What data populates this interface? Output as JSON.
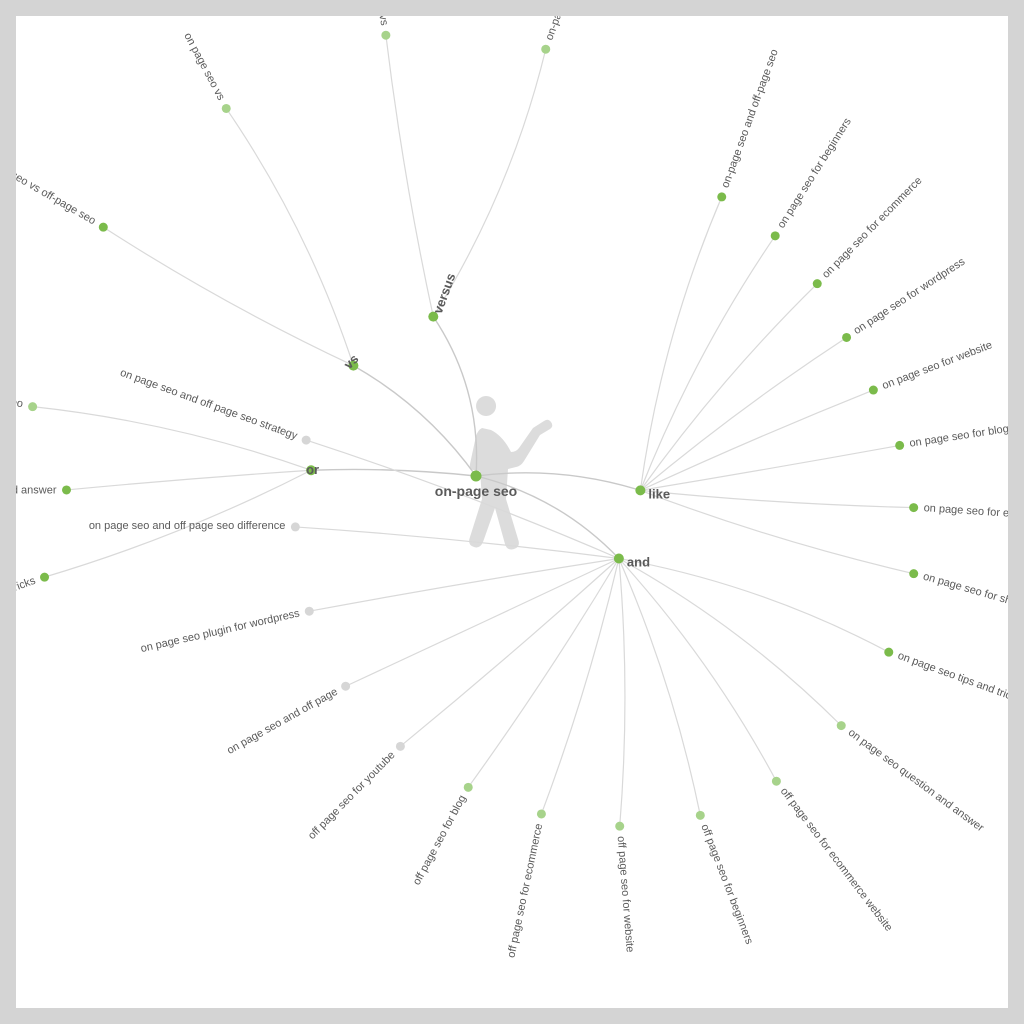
{
  "colors": {
    "accent": "#7bbb4b",
    "accent_light": "#a7d38b",
    "muted": "#d6d6d6",
    "text": "#5a5a5a",
    "frame_bg": "#ffffff",
    "page_bg": "#d4d4d4"
  },
  "center": {
    "label": "on-page seo"
  },
  "branches": {
    "versus": {
      "label": "versus",
      "leaves": [
        {
          "text": "on-page vs off-page seo",
          "strength": "md"
        },
        {
          "text": "on page seo vs",
          "strength": "md"
        }
      ]
    },
    "vs": {
      "label": "vs",
      "leaves": [
        {
          "text": "on page seo vs",
          "strength": "md"
        },
        {
          "text": "on-page seo vs off-page seo",
          "strength": "hi"
        }
      ]
    },
    "or": {
      "label": "or",
      "leaves": [
        {
          "text": "on page seo or off page seo",
          "strength": "md"
        },
        {
          "text": "on page seo question and answer",
          "strength": "hi"
        },
        {
          "text": "on page seo tips and tricks",
          "strength": "hi"
        }
      ]
    },
    "like": {
      "label": "like",
      "leaves": [
        {
          "text": "on-page seo and off-page seo",
          "strength": "hi"
        },
        {
          "text": "on page seo for beginners",
          "strength": "hi"
        },
        {
          "text": "on page seo for ecommerce",
          "strength": "hi"
        },
        {
          "text": "on page seo for wordpress",
          "strength": "hi"
        },
        {
          "text": "on page seo for website",
          "strength": "hi"
        },
        {
          "text": "on page seo for blogger",
          "strength": "hi"
        },
        {
          "text": "on page seo for ecommerce website",
          "strength": "hi"
        },
        {
          "text": "on page seo for shopify",
          "strength": "hi"
        }
      ]
    },
    "and": {
      "label": "and",
      "leaves": [
        {
          "text": "on page seo tips and tricks",
          "strength": "hi"
        },
        {
          "text": "on page seo question and answer",
          "strength": "md"
        },
        {
          "text": "off page seo for ecommerce website",
          "strength": "md"
        },
        {
          "text": "off page seo for beginners",
          "strength": "md"
        },
        {
          "text": "off page seo for website",
          "strength": "md"
        },
        {
          "text": "off page seo for ecommerce",
          "strength": "md"
        },
        {
          "text": "off page seo for blog",
          "strength": "md"
        },
        {
          "text": "off page seo for youtube",
          "strength": "lo"
        },
        {
          "text": "on page seo and off page",
          "strength": "lo"
        },
        {
          "text": "on page seo plugin for wordpress",
          "strength": "lo"
        },
        {
          "text": "on page seo and off page seo difference",
          "strength": "lo"
        },
        {
          "text": "on page seo and off page seo strategy",
          "strength": "lo"
        }
      ]
    }
  }
}
